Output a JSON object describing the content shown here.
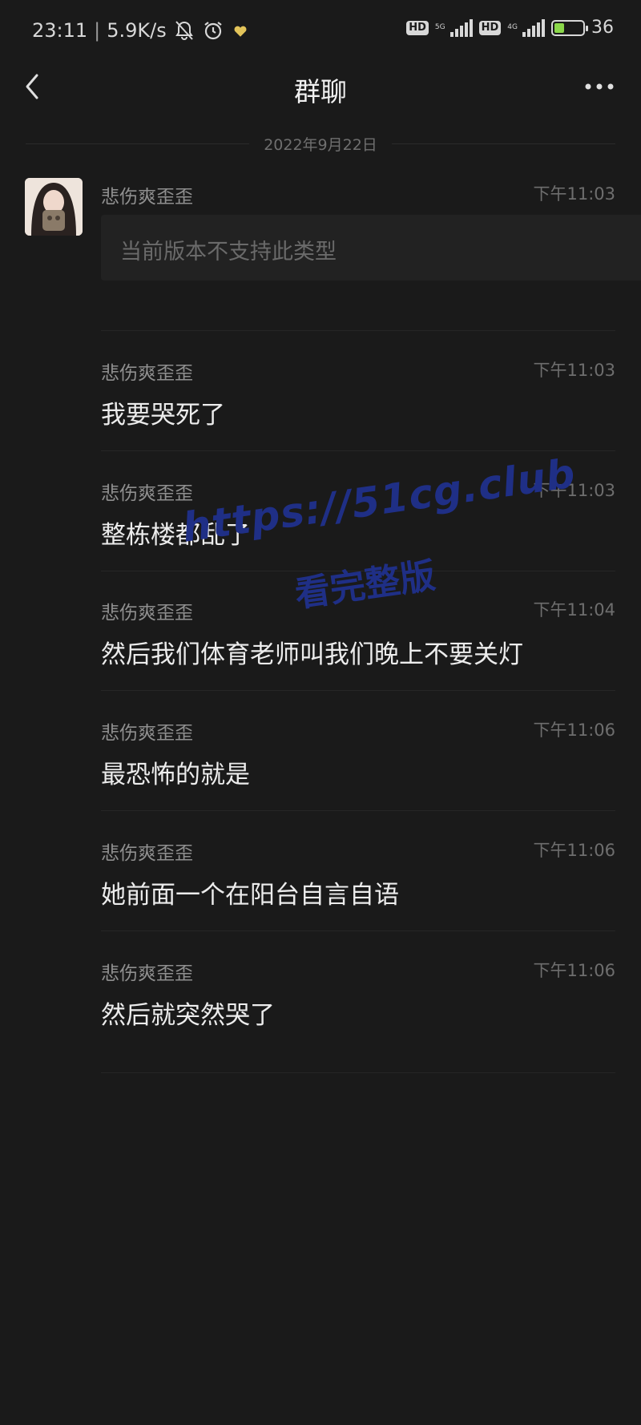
{
  "status_bar": {
    "time": "23:11",
    "speed": "5.9K/s",
    "network1_label": "HD",
    "network1_type": "5G",
    "network2_label": "HD",
    "network2_type": "4G",
    "battery_percent": "36",
    "battery_level": 0.36
  },
  "header": {
    "title": "群聊"
  },
  "date_divider": "2022年9月22日",
  "messages": [
    {
      "sender": "悲伤爽歪歪",
      "time": "下午11:03",
      "text": "当前版本不支持此类型"
    },
    {
      "sender": "悲伤爽歪歪",
      "time": "下午11:03",
      "text": "我要哭死了"
    },
    {
      "sender": "悲伤爽歪歪",
      "time": "下午11:03",
      "text": "整栋楼都乱了"
    },
    {
      "sender": "悲伤爽歪歪",
      "time": "下午11:04",
      "text": "然后我们体育老师叫我们晚上不要关灯"
    },
    {
      "sender": "悲伤爽歪歪",
      "time": "下午11:06",
      "text": "最恐怖的就是"
    },
    {
      "sender": "悲伤爽歪歪",
      "time": "下午11:06",
      "text": "她前面一个在阳台自言自语"
    },
    {
      "sender": "悲伤爽歪歪",
      "time": "下午11:06",
      "text": "然后就突然哭了"
    }
  ],
  "watermark": {
    "url": "https://51cg.club",
    "subtitle": "看完整版"
  },
  "colors": {
    "background": "#1a1a1a",
    "watermark": "#1f2f86",
    "battery_fill": "#8bd84a"
  }
}
